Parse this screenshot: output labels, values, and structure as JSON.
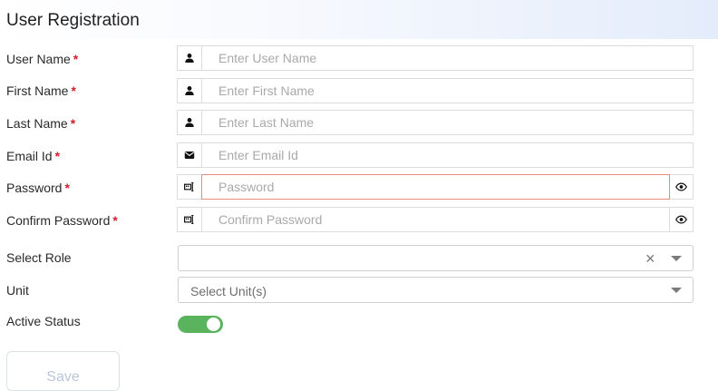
{
  "header": {
    "title": "User Registration"
  },
  "form": {
    "required_marker": "*",
    "fields": [
      {
        "label": "User Name",
        "placeholder": "Enter User Name",
        "icon": "user-icon"
      },
      {
        "label": "First Name",
        "placeholder": "Enter First Name",
        "icon": "user-icon"
      },
      {
        "label": "Last Name",
        "placeholder": "Enter Last Name",
        "icon": "user-icon"
      },
      {
        "label": "Email Id",
        "placeholder": "Enter Email Id",
        "icon": "envelope-icon"
      },
      {
        "label": "Password",
        "placeholder": "Password",
        "icon": "key-icon",
        "toggle_icon": "eye-icon",
        "error": true
      },
      {
        "label": "Confirm Password",
        "placeholder": "Confirm Password",
        "icon": "key-icon",
        "toggle_icon": "eye-icon"
      }
    ],
    "role": {
      "label": "Select Role",
      "value": "",
      "clear_glyph": "×"
    },
    "unit": {
      "label": "Unit",
      "placeholder": "Select Unit(s)"
    },
    "active_status": {
      "label": "Active Status",
      "on": true
    },
    "save_label": "Save"
  },
  "colors": {
    "required": "#d21f2b",
    "toggle_on": "#5ab45e",
    "error_border": "#e98a7e",
    "save_text": "#b7c7d8"
  }
}
